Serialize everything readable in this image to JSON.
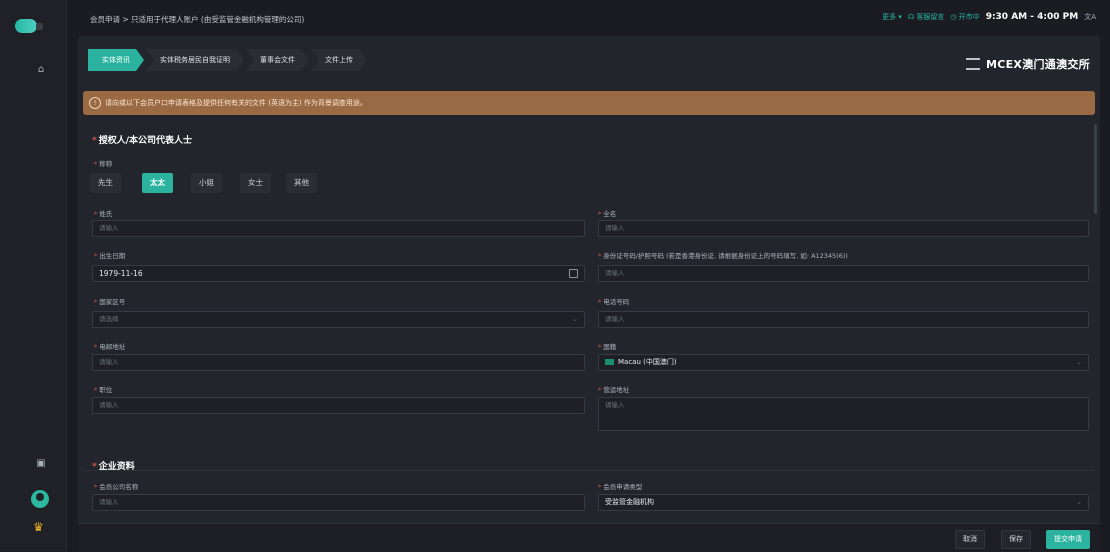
{
  "topbar": {
    "breadcrumb": "会员申请 > 只适用于代理人账户 (由受监管金融机构管理的公司)",
    "more": "更多 ▾",
    "service": "☊ 客服留言",
    "market_status": "◷ 开市中",
    "hours": "9:30 AM - 4:00 PM",
    "lang_icon": "文A"
  },
  "steps": [
    "实体资讯",
    "实体税务居民自我证明",
    "董事会文件",
    "文件上传"
  ],
  "brand": {
    "name": "MCEX澳门通澳交所"
  },
  "notice": {
    "icon": "!",
    "text": "请向或以下会员户口申请表格及提供任何有关的文件 (英语为主) 作为背景调查用途。"
  },
  "section1": {
    "title": "授权人/本公司代表人士",
    "title_label": "称称",
    "titles": [
      "先生",
      "太太",
      "小姐",
      "女士",
      "其他"
    ],
    "active_title": "太太",
    "surname": {
      "label": "姓氏",
      "placeholder": "请输入"
    },
    "fullname": {
      "label": "全名",
      "placeholder": "请输入"
    },
    "dob": {
      "label": "出生日期",
      "value": "1979-11-16"
    },
    "id": {
      "label": "身份证号码/护照号码 (若是香港身份证, 请根据身份证上的号码填写, 如: A12345(6))",
      "placeholder": "请输入"
    },
    "country_code": {
      "label": "国家区号",
      "placeholder": "请选择"
    },
    "phone": {
      "label": "电话号码",
      "placeholder": "请输入"
    },
    "email": {
      "label": "电邮地址",
      "placeholder": "请输入"
    },
    "nationality": {
      "label": "国籍",
      "value": "Macau (中国澳门)"
    },
    "position": {
      "label": "职位",
      "placeholder": "请输入"
    },
    "address": {
      "label": "营运地址",
      "placeholder": "请输入"
    }
  },
  "section2": {
    "title": "企业资料",
    "company": {
      "label": "会员公司名称",
      "placeholder": "请输入"
    },
    "member_type": {
      "label": "会员申请类型",
      "value": "受监管金融机构"
    }
  },
  "footer": {
    "cancel": "取消",
    "save": "保存",
    "submit": "提交申请"
  },
  "colors": {
    "accent": "#2bb39f",
    "notice": "#9a6a44",
    "background": "#1a1c21"
  }
}
